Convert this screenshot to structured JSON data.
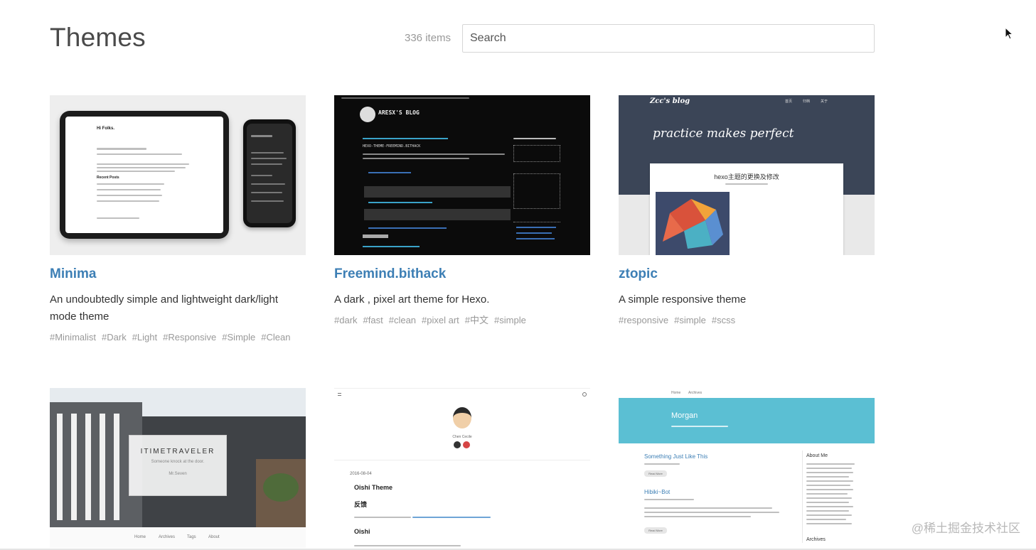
{
  "header": {
    "title": "Themes",
    "count": "336 items",
    "search_placeholder": "Search"
  },
  "themes": [
    {
      "name": "Minima",
      "description": "An undoubtedly simple and lightweight dark/light mode theme",
      "tags": [
        "#Minimalist",
        "#Dark",
        "#Light",
        "#Responsive",
        "#Simple",
        "#Clean"
      ]
    },
    {
      "name": "Freemind.bithack",
      "description": "A dark , pixel art theme for Hexo.",
      "tags": [
        "#dark",
        "#fast",
        "#clean",
        "#pixel art",
        "#中文",
        "#simple"
      ]
    },
    {
      "name": "ztopic",
      "description": "A simple responsive theme",
      "tags": [
        "#responsive",
        "#simple",
        "#scss"
      ]
    }
  ],
  "thumbnails": {
    "minima": {
      "heading": "Hi Folks.",
      "section": "Recent Posts"
    },
    "freemind": {
      "blog_title": "ARESX'S BLOG",
      "repo_line": "HEXO-THEME-FREEMIND.BITHACK"
    },
    "ztopic": {
      "blog_name": "Zcc's blog",
      "tagline": "practice makes perfect",
      "post_title": "hexo主题的更换及修改",
      "nav": [
        "首页",
        "归档",
        "关于"
      ]
    },
    "timetraveler": {
      "title": "ITIMETRAVELER",
      "subtitle": "Someone knock at the door.",
      "author": "Mr.Seven",
      "nav": [
        "Home",
        "Archives",
        "Tags",
        "About"
      ]
    },
    "oishi": {
      "date": "2016-08-04",
      "post_title": "Oishi Theme",
      "sub": "反馈",
      "heading": "Oishi",
      "author": "Chen Cecile"
    },
    "morgan": {
      "nav": [
        "Home",
        "Archives"
      ],
      "blog_name": "Morgan",
      "post1": "Something Just Like This",
      "post2": "Hibiki~Bot",
      "sidebar": "About Me",
      "archives": "Archives",
      "more_label": "Read More"
    }
  },
  "watermark": "@稀土掘金技术社区"
}
